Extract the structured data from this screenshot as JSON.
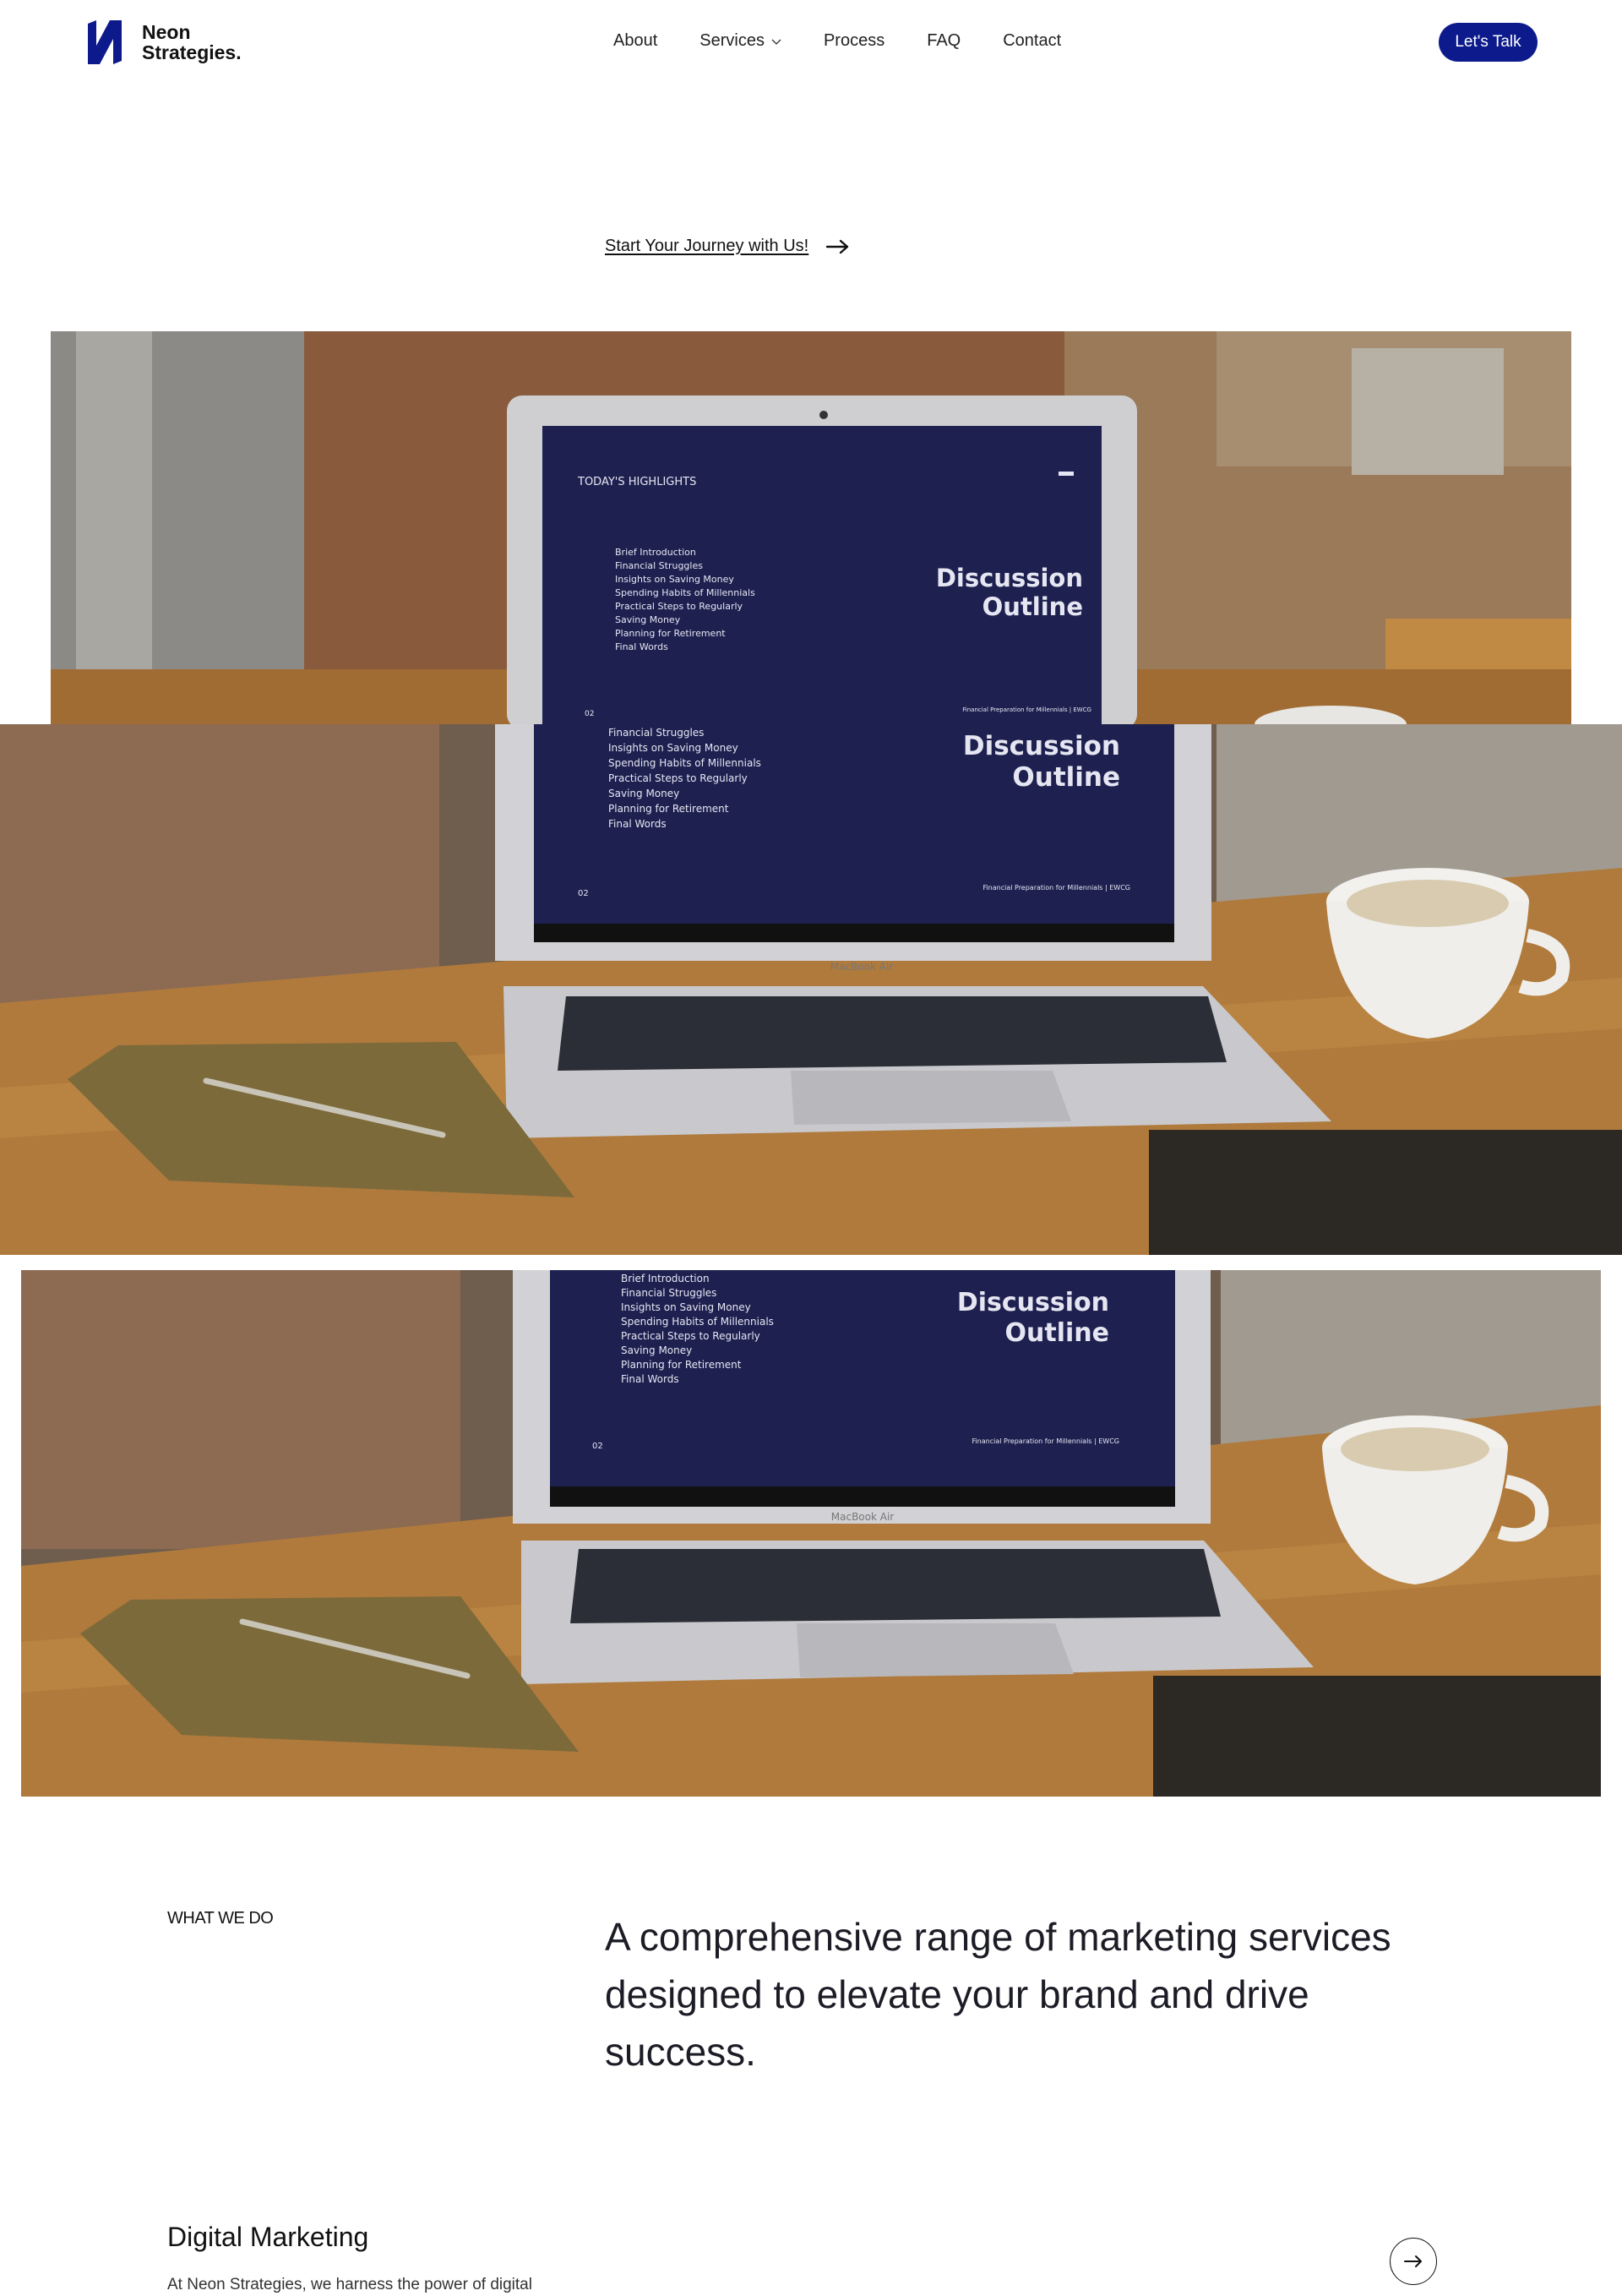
{
  "nav": {
    "logo_line1": "Neon",
    "logo_line2": "Strategies.",
    "links": [
      "About",
      "Services",
      "Process",
      "FAQ",
      "Contact"
    ],
    "cta": "Let's Talk"
  },
  "hero": {
    "journey_link": "Start Your Journey with Us!"
  },
  "media": {
    "screen_header": "TODAY'S HIGHLIGHTS",
    "screen_items": [
      "Brief Introduction",
      "Financial Struggles",
      "Insights on Saving Money",
      "Spending Habits of Millennials",
      "Practical Steps to Regularly",
      "Saving Money",
      "Planning for Retirement",
      "Final Words"
    ],
    "screen_title_1": "Discussion",
    "screen_title_2": "Outline",
    "screen_page": "02",
    "screen_footer": "Financial Preparation for Millennials | EWCG",
    "laptop_brand": "MacBook Air"
  },
  "what_we_do": {
    "label": "WHAT WE DO",
    "headline": "A comprehensive range of marketing services designed to elevate your brand and drive success."
  },
  "service": {
    "title": "Digital Marketing",
    "description": "At Neon Strategies, we harness the power of digital"
  },
  "colors": {
    "brand": "#0d1a8c",
    "screen": "#1e2150",
    "wood": "#b07a3c"
  }
}
